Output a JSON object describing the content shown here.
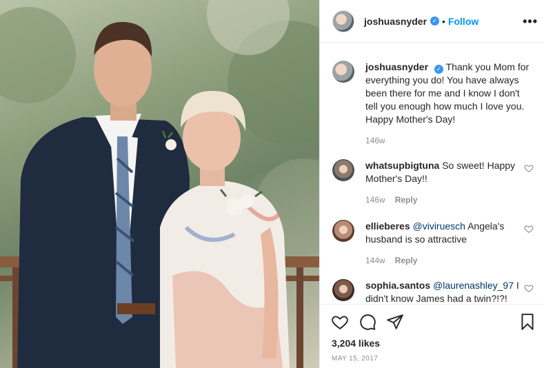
{
  "header": {
    "username": "joshuasnyder",
    "verified": true,
    "follow_label": "Follow",
    "more_label": "•••"
  },
  "caption": {
    "username": "joshuasnyder",
    "text": "Thank you Mom for everything you do!  You have always been there for me and I know I don't tell you enough how much I love you.  Happy Mother's Day!",
    "time": "146w"
  },
  "comments": [
    {
      "username": "whatsupbigtuna",
      "mention": "",
      "text": "So sweet! Happy Mother's Day!!",
      "time": "146w",
      "reply_label": "Reply"
    },
    {
      "username": "ellieberes",
      "mention": "@viviruesch",
      "text": "Angela's husband is so attractive",
      "time": "144w",
      "reply_label": "Reply"
    },
    {
      "username": "sophia.santos",
      "mention": "@laurenashley_97",
      "text": "I didn't know James had a twin?!?!",
      "time": "",
      "reply_label": ""
    }
  ],
  "actions": {
    "likes": "3,204 likes",
    "date": "MAY 15, 2017",
    "icons": [
      "heart-icon",
      "comment-icon",
      "share-icon",
      "bookmark-icon"
    ]
  },
  "colors": {
    "accent": "#0095f6",
    "verified": "#3897f0",
    "muted": "#8e8e8e",
    "text": "#262626"
  }
}
